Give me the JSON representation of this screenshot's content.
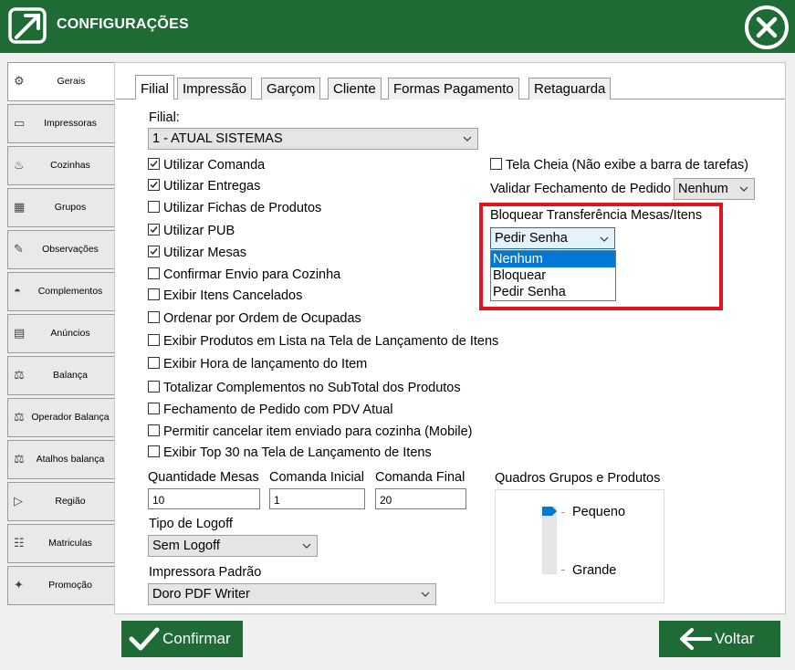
{
  "window": {
    "title": "CONFIGURAÇÕES"
  },
  "sidebar": {
    "items": [
      {
        "label": "Gerais",
        "icon": "settings-icon"
      },
      {
        "label": "Impressoras",
        "icon": "printer-icon"
      },
      {
        "label": "Cozinhas",
        "icon": "kitchen-icon"
      },
      {
        "label": "Grupos",
        "icon": "groups-icon"
      },
      {
        "label": "Observações",
        "icon": "notes-icon"
      },
      {
        "label": "Complementos",
        "icon": "complements-icon"
      },
      {
        "label": "Anúncios",
        "icon": "announcement-icon"
      },
      {
        "label": "Balança",
        "icon": "scale-icon"
      },
      {
        "label": "Operador Balança",
        "icon": "scale-operator-icon"
      },
      {
        "label": "Atalhos balança",
        "icon": "scale-shortcut-icon"
      },
      {
        "label": "Região",
        "icon": "region-icon"
      },
      {
        "label": "Matriculas",
        "icon": "registration-icon"
      },
      {
        "label": "Promoção",
        "icon": "promotion-icon"
      }
    ]
  },
  "tabs": [
    "Filial",
    "Impressão",
    "Garçom",
    "Cliente",
    "Formas Pagamento",
    "Retaguarda"
  ],
  "filial": {
    "label": "Filial:",
    "value": "1 - ATUAL SISTEMAS"
  },
  "checkboxes": [
    {
      "label": "Utilizar Comanda",
      "checked": true
    },
    {
      "label": "Utilizar Entregas",
      "checked": true
    },
    {
      "label": "Utilizar Fichas de Produtos",
      "checked": false
    },
    {
      "label": "Utilizar PUB",
      "checked": true
    },
    {
      "label": "Utilizar Mesas",
      "checked": true
    },
    {
      "label": "Confirmar Envio para Cozinha",
      "checked": false
    },
    {
      "label": "Exibir Itens Cancelados",
      "checked": false
    },
    {
      "label": "Ordenar por Ordem de Ocupadas",
      "checked": false
    },
    {
      "label": "Exibir Produtos em Lista na Tela de Lançamento de Itens",
      "checked": false
    },
    {
      "label": "Exibir Hora de lançamento do Item",
      "checked": false
    },
    {
      "label": "Totalizar Complementos no SubTotal dos Produtos",
      "checked": false
    },
    {
      "label": "Fechamento de Pedido com PDV Atual",
      "checked": false
    },
    {
      "label": "Permitir cancelar item enviado para cozinha (Mobile)",
      "checked": false
    },
    {
      "label": "Exibir Top 30 na Tela de Lançamento de Itens",
      "checked": false
    }
  ],
  "right": {
    "tela_cheia": {
      "label": "Tela Cheia (Não exibe a barra de tarefas)",
      "checked": false
    },
    "validar_label": "Validar Fechamento de Pedido",
    "validar_value": "Nenhum",
    "bloquear_label": "Bloquear Transferência Mesas/Itens",
    "bloquear_value": "Pedir Senha",
    "bloquear_options": [
      "Nenhum",
      "Bloquear",
      "Pedir Senha"
    ],
    "highlight_color": "#e3121b"
  },
  "fields": {
    "qtd_mesas_label": "Quantidade Mesas",
    "qtd_mesas_value": "10",
    "comanda_inicial_label": "Comanda Inicial",
    "comanda_inicial_value": "1",
    "comanda_final_label": "Comanda Final",
    "comanda_final_value": "20",
    "logoff_label": "Tipo de Logoff",
    "logoff_value": "Sem Logoff",
    "impressora_label": "Impressora Padrão",
    "impressora_value": "Doro PDF Writer"
  },
  "quadros": {
    "label": "Quadros Grupos e Produtos",
    "min_label": "Pequeno",
    "max_label": "Grande",
    "slider_level": 0
  },
  "buttons": {
    "confirm": "Confirmar",
    "back": "Voltar"
  },
  "colors": {
    "brand": "#1f6b35",
    "selection": "#0078d7"
  }
}
